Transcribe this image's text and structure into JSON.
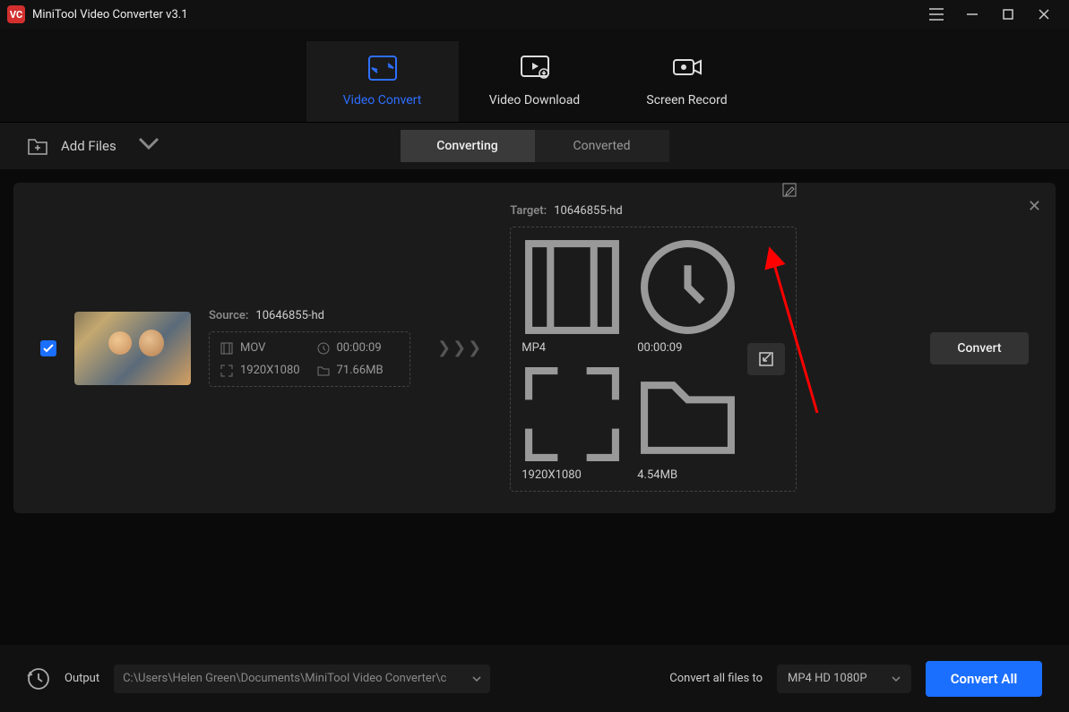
{
  "app": {
    "title": "MiniTool Video Converter v3.1"
  },
  "tabs": {
    "convert": "Video Convert",
    "download": "Video Download",
    "record": "Screen Record"
  },
  "toolbar": {
    "add_files": "Add Files"
  },
  "subtabs": {
    "converting": "Converting",
    "converted": "Converted"
  },
  "item": {
    "source_label": "Source:",
    "source_name": "10646855-hd",
    "source_format": "MOV",
    "source_duration": "00:00:09",
    "source_resolution": "1920X1080",
    "source_size": "71.66MB",
    "target_label": "Target:",
    "target_name": "10646855-hd",
    "target_format": "MP4",
    "target_duration": "00:00:09",
    "target_resolution": "1920X1080",
    "target_size": "4.54MB",
    "convert": "Convert"
  },
  "footer": {
    "output_label": "Output",
    "output_path": "C:\\Users\\Helen Green\\Documents\\MiniTool Video Converter\\c",
    "convert_all_label": "Convert all files to",
    "preset": "MP4 HD 1080P",
    "convert_all": "Convert All"
  }
}
